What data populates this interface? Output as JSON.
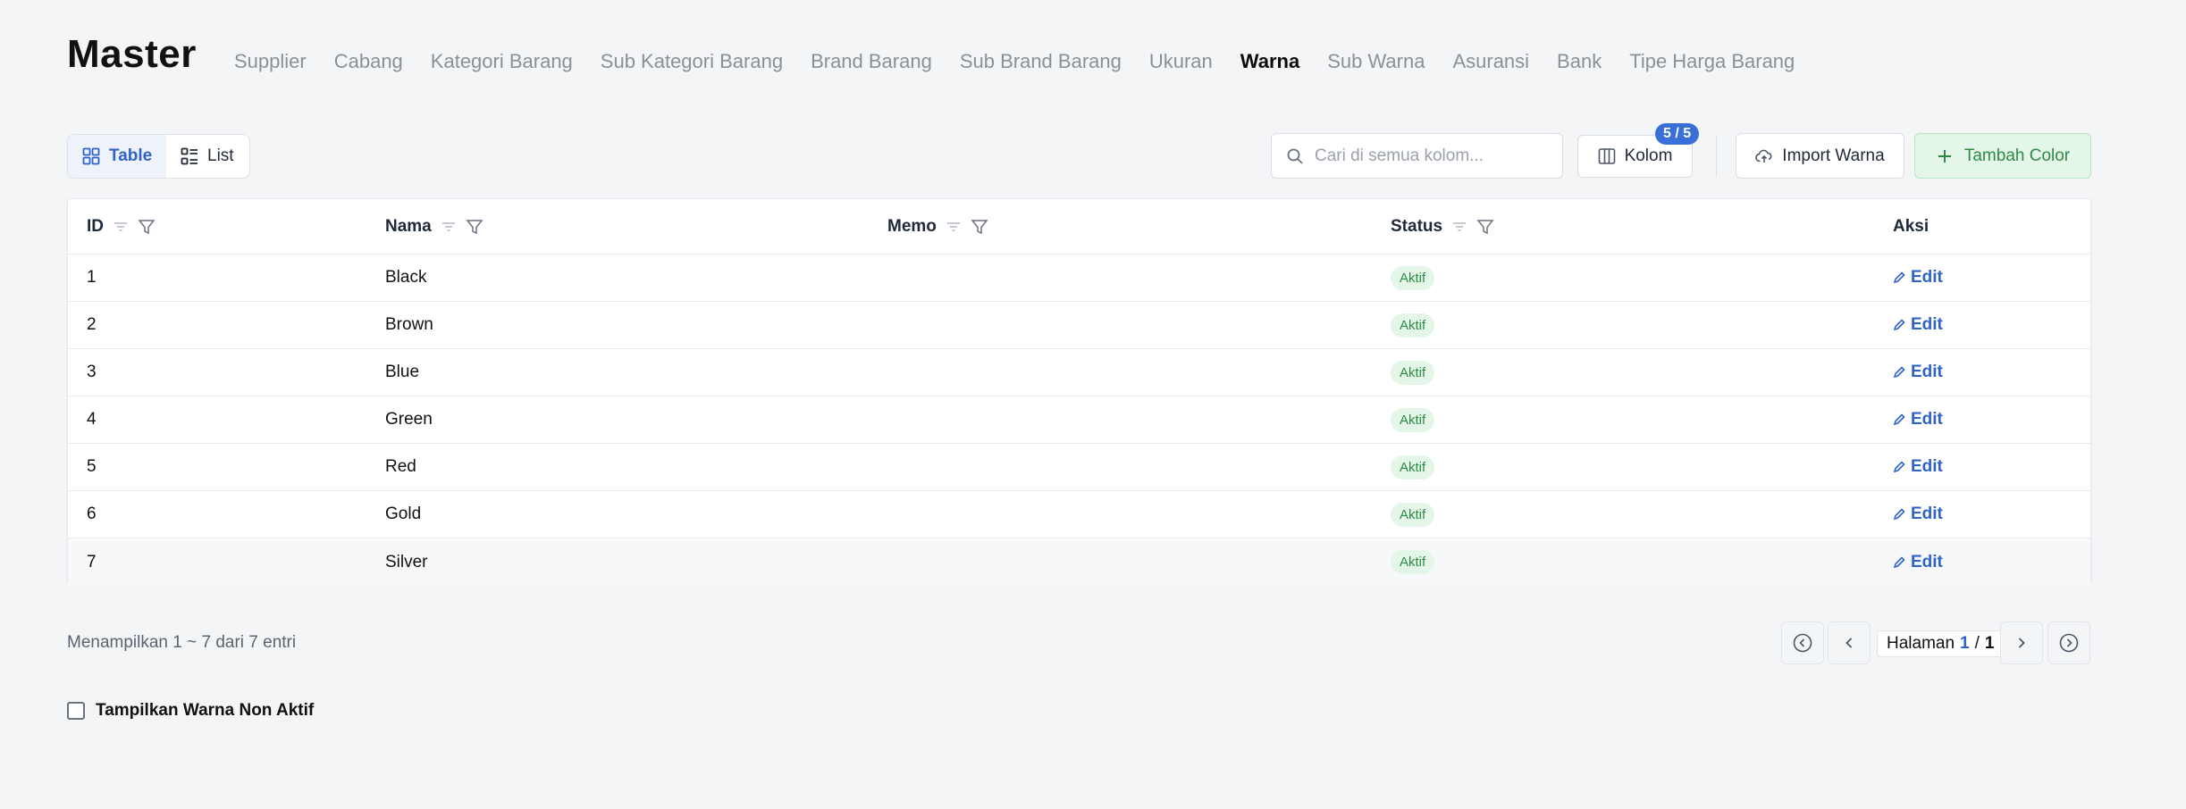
{
  "page": {
    "title": "Master"
  },
  "nav": [
    {
      "label": "Supplier"
    },
    {
      "label": "Cabang"
    },
    {
      "label": "Kategori Barang"
    },
    {
      "label": "Sub Kategori Barang"
    },
    {
      "label": "Brand Barang"
    },
    {
      "label": "Sub Brand Barang"
    },
    {
      "label": "Ukuran"
    },
    {
      "label": "Warna",
      "active": true
    },
    {
      "label": "Sub Warna"
    },
    {
      "label": "Asuransi"
    },
    {
      "label": "Bank"
    },
    {
      "label": "Tipe Harga Barang"
    }
  ],
  "toolbar": {
    "view_table": "Table",
    "view_list": "List",
    "search_placeholder": "Cari di semua kolom...",
    "kolom_label": "Kolom",
    "kolom_badge": "5 / 5",
    "import_label": "Import Warna",
    "add_label": "Tambah Color"
  },
  "table": {
    "headers": {
      "id": "ID",
      "nama": "Nama",
      "memo": "Memo",
      "status": "Status",
      "aksi": "Aksi"
    },
    "rows": [
      {
        "id": "1",
        "nama": "Black",
        "memo": "",
        "status": "Aktif",
        "action": "Edit"
      },
      {
        "id": "2",
        "nama": "Brown",
        "memo": "",
        "status": "Aktif",
        "action": "Edit"
      },
      {
        "id": "3",
        "nama": "Blue",
        "memo": "",
        "status": "Aktif",
        "action": "Edit"
      },
      {
        "id": "4",
        "nama": "Green",
        "memo": "",
        "status": "Aktif",
        "action": "Edit"
      },
      {
        "id": "5",
        "nama": "Red",
        "memo": "",
        "status": "Aktif",
        "action": "Edit"
      },
      {
        "id": "6",
        "nama": "Gold",
        "memo": "",
        "status": "Aktif",
        "action": "Edit"
      },
      {
        "id": "7",
        "nama": "Silver",
        "memo": "",
        "status": "Aktif",
        "action": "Edit"
      }
    ]
  },
  "footer": {
    "info": "Menampilkan 1 ~ 7 dari 7 entri",
    "page_label": "Halaman",
    "page_current": "1",
    "page_sep": "/",
    "page_total": "1",
    "checkbox_label": "Tampilkan Warna Non Aktif"
  },
  "colors": {
    "accent": "#2f63c8",
    "badge_bg": "#3b6fd8",
    "success_bg": "#e3f6e8",
    "success_text": "#2f8a47"
  }
}
